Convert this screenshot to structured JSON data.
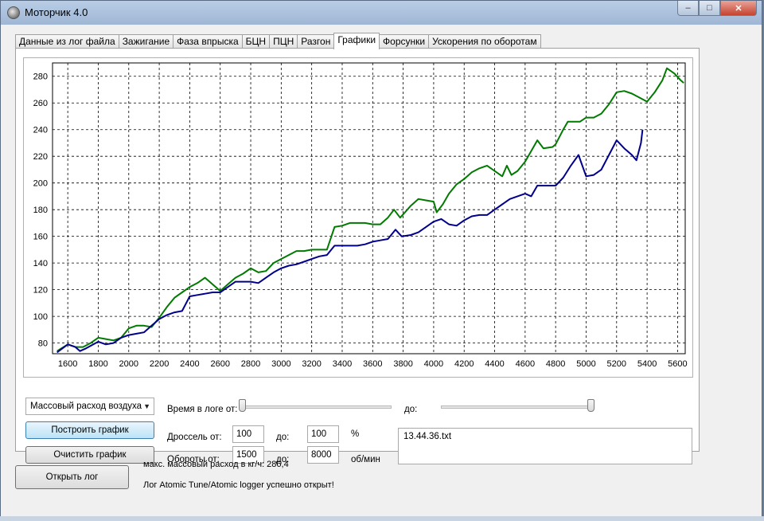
{
  "window": {
    "title": "Моторчик 4.0",
    "close_glyph": "✕",
    "min_glyph": "–",
    "max_glyph": "□"
  },
  "tabs": [
    {
      "label": "Данные из лог файла"
    },
    {
      "label": "Зажигание"
    },
    {
      "label": "Фаза впрыска"
    },
    {
      "label": "БЦН"
    },
    {
      "label": "ПЦН"
    },
    {
      "label": "Разгон"
    },
    {
      "label": "Графики",
      "active": true
    },
    {
      "label": "Форсунки"
    },
    {
      "label": "Ускорения по оборотам"
    }
  ],
  "chart_data": {
    "type": "line",
    "xlim": [
      1500,
      5650
    ],
    "ylim": [
      72,
      290
    ],
    "x_ticks": [
      1600,
      1800,
      2000,
      2200,
      2400,
      2600,
      2800,
      3000,
      3200,
      3400,
      3600,
      3800,
      4000,
      4200,
      4400,
      4600,
      4800,
      5000,
      5200,
      5400,
      5600
    ],
    "y_ticks": [
      80,
      100,
      120,
      140,
      160,
      180,
      200,
      220,
      240,
      260,
      280
    ],
    "grid": true,
    "series": [
      {
        "color": "#007a00",
        "points": [
          [
            1530,
            74
          ],
          [
            1600,
            79
          ],
          [
            1650,
            77
          ],
          [
            1700,
            77
          ],
          [
            1750,
            80
          ],
          [
            1800,
            84
          ],
          [
            1850,
            83
          ],
          [
            1900,
            82
          ],
          [
            1950,
            84
          ],
          [
            2000,
            91
          ],
          [
            2050,
            93
          ],
          [
            2100,
            93
          ],
          [
            2150,
            92
          ],
          [
            2200,
            99
          ],
          [
            2250,
            107
          ],
          [
            2300,
            114
          ],
          [
            2350,
            118
          ],
          [
            2400,
            122
          ],
          [
            2450,
            125
          ],
          [
            2500,
            129
          ],
          [
            2550,
            124
          ],
          [
            2600,
            119
          ],
          [
            2650,
            124
          ],
          [
            2700,
            129
          ],
          [
            2750,
            132
          ],
          [
            2800,
            136
          ],
          [
            2850,
            133
          ],
          [
            2900,
            134
          ],
          [
            2950,
            140
          ],
          [
            3000,
            143
          ],
          [
            3050,
            146
          ],
          [
            3100,
            149
          ],
          [
            3150,
            149
          ],
          [
            3200,
            150
          ],
          [
            3250,
            150
          ],
          [
            3300,
            150
          ],
          [
            3350,
            167
          ],
          [
            3400,
            168
          ],
          [
            3450,
            170
          ],
          [
            3500,
            170
          ],
          [
            3550,
            170
          ],
          [
            3600,
            169
          ],
          [
            3650,
            169
          ],
          [
            3700,
            174
          ],
          [
            3740,
            180
          ],
          [
            3780,
            174
          ],
          [
            3820,
            179
          ],
          [
            3850,
            183
          ],
          [
            3900,
            188
          ],
          [
            3950,
            187
          ],
          [
            4000,
            186
          ],
          [
            4020,
            178
          ],
          [
            4060,
            184
          ],
          [
            4100,
            192
          ],
          [
            4150,
            199
          ],
          [
            4200,
            203
          ],
          [
            4250,
            208
          ],
          [
            4300,
            211
          ],
          [
            4350,
            213
          ],
          [
            4400,
            209
          ],
          [
            4450,
            205
          ],
          [
            4480,
            213
          ],
          [
            4510,
            206
          ],
          [
            4550,
            209
          ],
          [
            4600,
            216
          ],
          [
            4650,
            226
          ],
          [
            4680,
            232
          ],
          [
            4720,
            226
          ],
          [
            4780,
            227
          ],
          [
            4800,
            229
          ],
          [
            4850,
            240
          ],
          [
            4880,
            246
          ],
          [
            4920,
            246
          ],
          [
            4960,
            246
          ],
          [
            5000,
            249
          ],
          [
            5050,
            249
          ],
          [
            5100,
            252
          ],
          [
            5150,
            259
          ],
          [
            5200,
            268
          ],
          [
            5250,
            269
          ],
          [
            5300,
            267
          ],
          [
            5350,
            264
          ],
          [
            5400,
            261
          ],
          [
            5450,
            268
          ],
          [
            5500,
            277
          ],
          [
            5530,
            286
          ],
          [
            5580,
            282
          ],
          [
            5620,
            277
          ],
          [
            5640,
            275
          ]
        ]
      },
      {
        "color": "#00008c",
        "points": [
          [
            1530,
            73
          ],
          [
            1600,
            79
          ],
          [
            1650,
            77
          ],
          [
            1680,
            74
          ],
          [
            1720,
            76
          ],
          [
            1800,
            81
          ],
          [
            1850,
            79
          ],
          [
            1900,
            80
          ],
          [
            1950,
            84
          ],
          [
            2000,
            86
          ],
          [
            2050,
            87
          ],
          [
            2100,
            88
          ],
          [
            2150,
            93
          ],
          [
            2200,
            98
          ],
          [
            2250,
            101
          ],
          [
            2300,
            103
          ],
          [
            2350,
            104
          ],
          [
            2400,
            115
          ],
          [
            2450,
            116
          ],
          [
            2500,
            117
          ],
          [
            2550,
            118
          ],
          [
            2600,
            118
          ],
          [
            2650,
            122
          ],
          [
            2700,
            126
          ],
          [
            2750,
            126
          ],
          [
            2800,
            126
          ],
          [
            2850,
            125
          ],
          [
            2900,
            129
          ],
          [
            2950,
            133
          ],
          [
            3000,
            136
          ],
          [
            3050,
            138
          ],
          [
            3100,
            139
          ],
          [
            3150,
            141
          ],
          [
            3200,
            143
          ],
          [
            3250,
            145
          ],
          [
            3300,
            146
          ],
          [
            3350,
            153
          ],
          [
            3400,
            153
          ],
          [
            3450,
            153
          ],
          [
            3500,
            153
          ],
          [
            3550,
            154
          ],
          [
            3600,
            156
          ],
          [
            3650,
            157
          ],
          [
            3700,
            158
          ],
          [
            3750,
            165
          ],
          [
            3790,
            160
          ],
          [
            3850,
            161
          ],
          [
            3900,
            163
          ],
          [
            3950,
            167
          ],
          [
            4000,
            171
          ],
          [
            4050,
            173
          ],
          [
            4100,
            169
          ],
          [
            4150,
            168
          ],
          [
            4200,
            172
          ],
          [
            4250,
            175
          ],
          [
            4300,
            176
          ],
          [
            4350,
            176
          ],
          [
            4400,
            180
          ],
          [
            4450,
            184
          ],
          [
            4500,
            188
          ],
          [
            4550,
            190
          ],
          [
            4600,
            192
          ],
          [
            4640,
            190
          ],
          [
            4680,
            198
          ],
          [
            4720,
            198
          ],
          [
            4760,
            198
          ],
          [
            4800,
            198
          ],
          [
            4850,
            204
          ],
          [
            4900,
            213
          ],
          [
            4950,
            221
          ],
          [
            5000,
            205
          ],
          [
            5050,
            206
          ],
          [
            5100,
            210
          ],
          [
            5150,
            221
          ],
          [
            5200,
            232
          ],
          [
            5250,
            226
          ],
          [
            5300,
            221
          ],
          [
            5330,
            217
          ],
          [
            5360,
            230
          ],
          [
            5370,
            240
          ]
        ]
      }
    ]
  },
  "controls": {
    "combo_value": "Массовый расход воздуха",
    "combo_arrow": "▼",
    "build_button": "Построить график",
    "clear_button": "Очистить график",
    "time_label": "Время в логе от:",
    "time_to_label": "до:",
    "time_from_fraction": 0.0,
    "time_to_fraction": 1.0,
    "throttle_label": "Дроссель от:",
    "throttle_from": "100",
    "throttle_to_label": "до:",
    "throttle_to": "100",
    "throttle_unit": "%",
    "rpm_label": "Обороты от:",
    "rpm_from": "1500",
    "rpm_to_label": "до:",
    "rpm_to": "8000",
    "rpm_unit": "об/мин",
    "file_name": "13.44.36.txt"
  },
  "footer": {
    "open_button": "Открыть лог",
    "max_flow_text": "макс. массовый расход в кг/ч: 286,4",
    "status_text": "Лог Atomic Tune/Atomic logger успешно открыт!"
  }
}
